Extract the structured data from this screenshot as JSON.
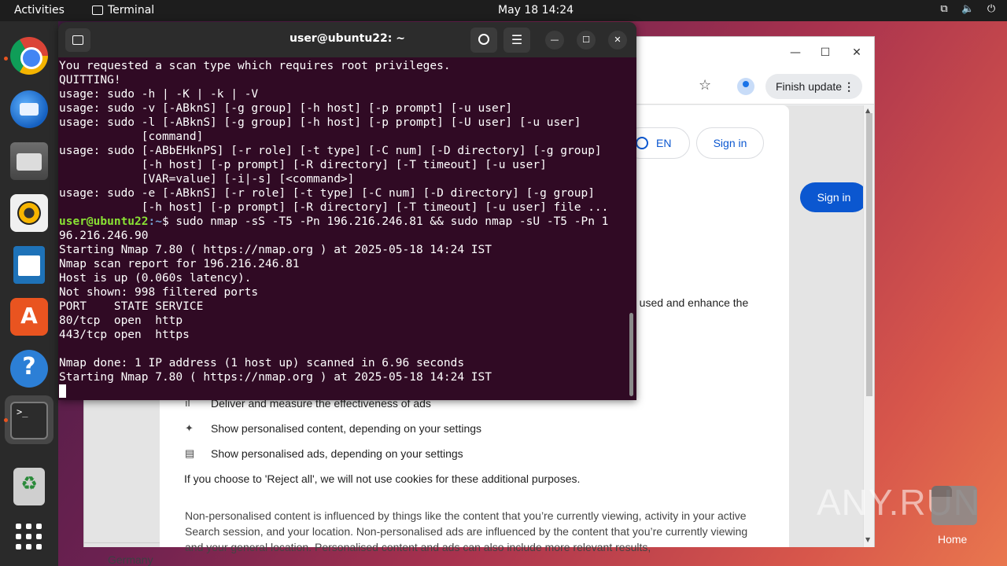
{
  "topbar": {
    "activities": "Activities",
    "app_name": "Terminal",
    "clock": "May 18  14:24"
  },
  "dock": {
    "items": [
      "chrome-icon",
      "thunderbird-icon",
      "files-icon",
      "rhythmbox-icon",
      "writer-icon",
      "app-center-icon",
      "help-icon",
      "terminal-icon",
      "trash-icon",
      "show-apps-icon"
    ]
  },
  "chrome": {
    "finish_update": "Finish update",
    "sign_in_bg": "Sign in",
    "lang": "EN",
    "sign_in": "Sign in",
    "partial_text": "e used and enhance the",
    "item1": "Deliver and measure the effectiveness of ads",
    "item2": "Show personalised content, depending on your settings",
    "item3": "Show personalised ads, depending on your settings",
    "reject_note": "If you choose to 'Reject all', we will not use cookies for these additional purposes.",
    "para": "Non-personalised content is influenced by things like the content that you’re currently viewing, activity in your active Search session, and your location. Non-personalised ads are influenced by the content that you’re currently viewing and your general location. Personalised content and ads can also include more relevant results,",
    "germany": "Germany"
  },
  "desktop": {
    "home_label": "Home",
    "watermark": "ANY.RUN"
  },
  "terminal": {
    "title": "user@ubuntu22: ~",
    "lines_before": [
      "You requested a scan type which requires root privileges.",
      "QUITTING!",
      "usage: sudo -h | -K | -k | -V",
      "usage: sudo -v [-ABknS] [-g group] [-h host] [-p prompt] [-u user]",
      "usage: sudo -l [-ABknS] [-g group] [-h host] [-p prompt] [-U user] [-u user]",
      "            [command]",
      "usage: sudo [-ABbEHknPS] [-r role] [-t type] [-C num] [-D directory] [-g group]",
      "            [-h host] [-p prompt] [-R directory] [-T timeout] [-u user]",
      "            [VAR=value] [-i|-s] [<command>]",
      "usage: sudo -e [-ABknS] [-r role] [-t type] [-C num] [-D directory] [-g group]",
      "            [-h host] [-p prompt] [-R directory] [-T timeout] [-u user] file ..."
    ],
    "prompt_user": "user@ubuntu22",
    "prompt_path": ":~",
    "command": "$ sudo nmap -sS -T5 -Pn 196.216.246.81 && sudo nmap -sU -T5 -Pn 1",
    "command_wrap": "96.216.246.90",
    "lines_after": [
      "Starting Nmap 7.80 ( https://nmap.org ) at 2025-05-18 14:24 IST",
      "Nmap scan report for 196.216.246.81",
      "Host is up (0.060s latency).",
      "Not shown: 998 filtered ports",
      "PORT    STATE SERVICE",
      "80/tcp  open  http",
      "443/tcp open  https",
      "",
      "Nmap done: 1 IP address (1 host up) scanned in 6.96 seconds",
      "Starting Nmap 7.80 ( https://nmap.org ) at 2025-05-18 14:24 IST"
    ]
  }
}
